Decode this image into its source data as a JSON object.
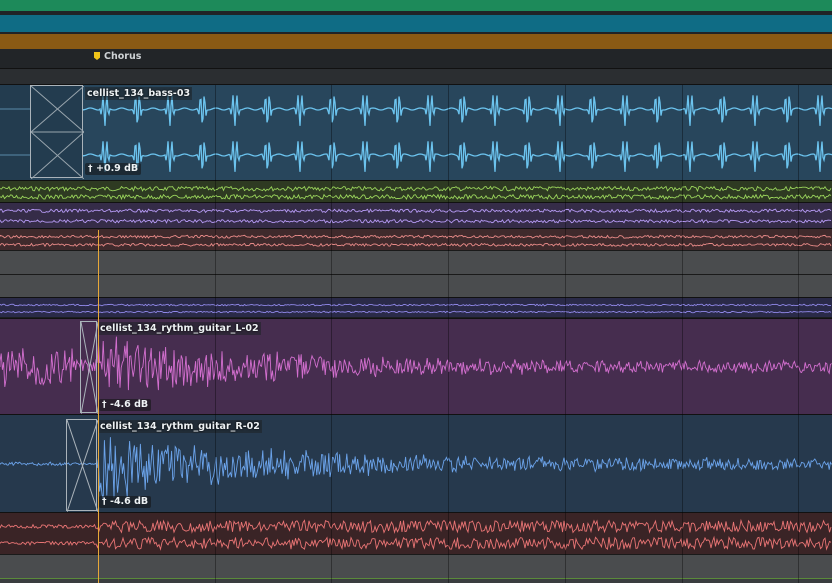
{
  "colors": {
    "folder_green": "#1d8a5a",
    "folder_teal": "#0f6c85",
    "folder_orange": "#8a5a14",
    "playhead": "#e8a838",
    "marker_flag": "#f0c419",
    "bass_clip_bg": "#28465c",
    "bass_wave": "#6cc4ef",
    "green_lane_wave": "#9ad45c",
    "purple_lane_wave": "#b69af4",
    "red_lane_wave": "#e88a88",
    "violet_lane_wave": "#9088e8",
    "guitar_l_bg": "#462d4f",
    "guitar_l_wave": "#d36fcf",
    "guitar_r_bg": "#26394d",
    "guitar_r_wave": "#6ba3ea",
    "red_bottom_wave": "#e87474"
  },
  "marker": {
    "label": "Chorus",
    "icon": "marker-flag-icon"
  },
  "clips": {
    "bass": {
      "name": "cellist_134_bass-03",
      "gain": "+0.9 dB",
      "gain_icon": "gain-handle-icon"
    },
    "guitar_l": {
      "name": "cellist_134_rythm_guitar_L-02",
      "gain": "-4.6 dB",
      "gain_icon": "gain-handle-icon"
    },
    "guitar_r": {
      "name": "cellist_134_rythm_guitar_R-02",
      "gain": "-4.6 dB",
      "gain_icon": "gain-handle-icon"
    }
  }
}
